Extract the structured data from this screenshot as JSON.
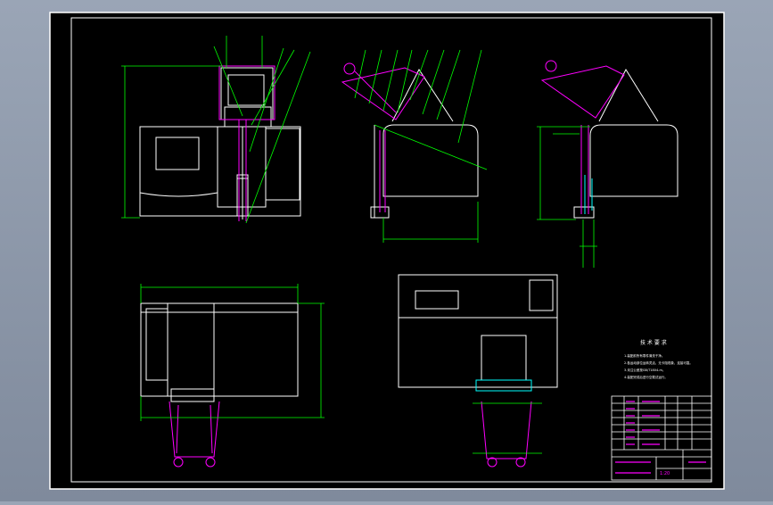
{
  "drawing": {
    "notes_title": "技 术 要 求",
    "notes_lines": [
      "1.装配前所有零件清洗干净。",
      "2.各运动部位运转灵活，无卡阻现象，连接可靠。",
      "3.未注公差按GB/T1804-m。",
      "4.装配完成后进行空载试运行。"
    ],
    "scale_label": "1:20",
    "colors": {
      "sheet": "#000000",
      "frame": "#ffffff",
      "dimension": "#00ff00",
      "part": "#ff00ff",
      "hidden": "#00ffff",
      "background": "#8a96a8"
    }
  }
}
